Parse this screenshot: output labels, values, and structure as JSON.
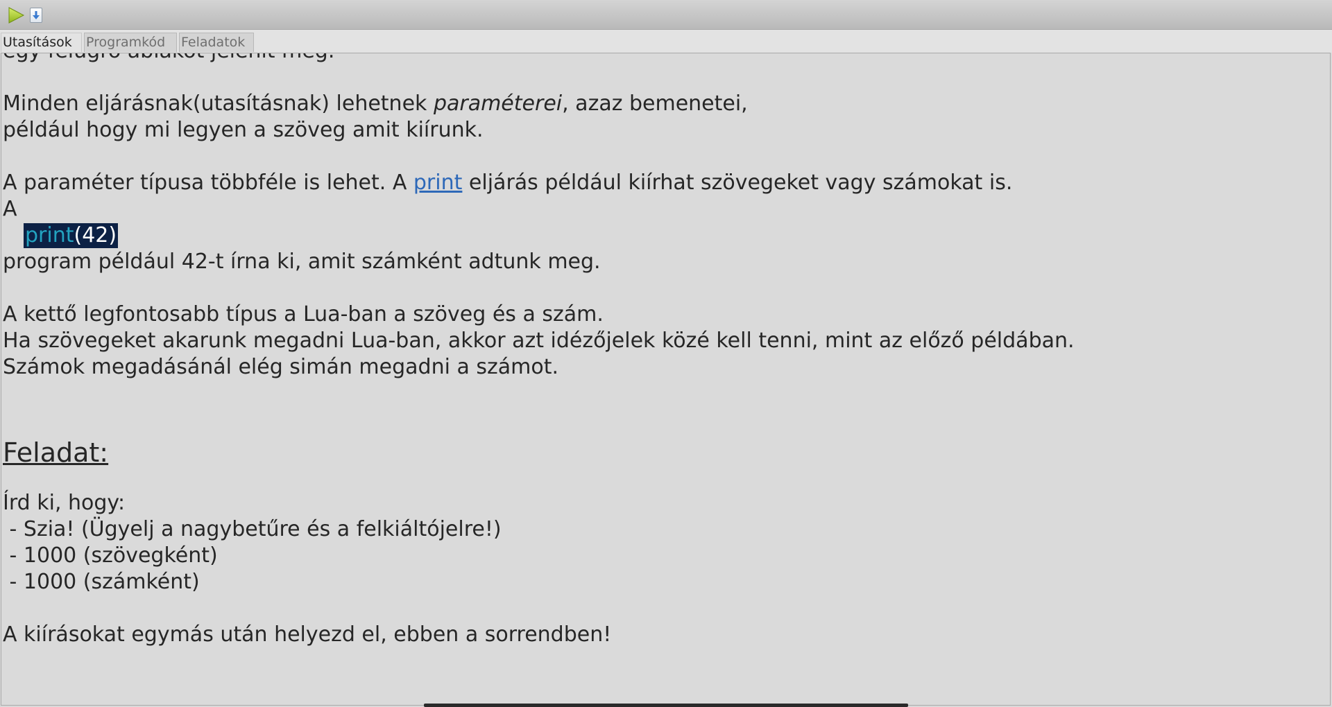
{
  "toolbar": {
    "run_icon": "play-icon",
    "step_icon": "step-into-icon"
  },
  "tabs": [
    {
      "label": "Utasítások",
      "active": true
    },
    {
      "label": "Programkód",
      "active": false
    },
    {
      "label": "Feladatok",
      "active": false
    }
  ],
  "doc": {
    "partial_top": "egy felugró ablakot jelenít meg.",
    "p1_pre": "Minden eljárásnak(utasításnak) lehetnek ",
    "p1_em": "paraméterei",
    "p1_post": ", azaz bemenetei,",
    "p2": "például hogy mi legyen a szöveg amit kiírunk.",
    "p3_pre": "A paraméter típusa többféle is lehet. A ",
    "p3_link": "print",
    "p3_post": " eljárás például kiírhat szövegeket vagy számokat is.",
    "p4": "A",
    "code_fn": "print",
    "code_args": "(42)",
    "p5": "program például 42-t írna ki, amit számként adtunk meg.",
    "p6": "A kettő legfontosabb típus a Lua-ban a szöveg és a szám.",
    "p7": "Ha szövegeket akarunk megadni Lua-ban, akkor azt idézőjelek közé kell tenni, mint az előző példában.",
    "p8": "Számok megadásánál elég simán megadni a számot.",
    "heading": "Feladat:",
    "t1": "Írd ki, hogy:",
    "t2": " - Szia! (Ügyelj a nagybetűre és a felkiáltójelre!)",
    "t3": " - 1000 (szövegként)",
    "t4": " - 1000 (számként)",
    "t5": "A kiírásokat egymás után helyezd el, ebben a sorrendben!"
  },
  "colors": {
    "background": "#d9d9d9",
    "link": "#2d68b8",
    "code_bg": "#0c2145",
    "code_fn": "#23a3c0"
  }
}
